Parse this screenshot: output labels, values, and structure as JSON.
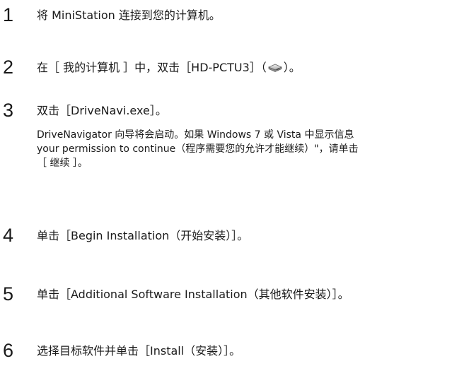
{
  "steps": [
    {
      "number": "1",
      "text": "将 MiniStation 连接到您的计算机。"
    },
    {
      "number": "2",
      "text_before": "在［ 我的计算机 ］中，双击［HD-PCTU3］（",
      "icon": "drive-icon",
      "text_after": "）。"
    },
    {
      "number": "3",
      "text": "双击［DriveNavi.exe］。",
      "sub_lines": [
        "DriveNavigator 向导将会启动。如果 Windows 7 或 Vista 中显示信息",
        "your permission to continue（程序需要您的允许才能继续）\"，请单击",
        "［ 继续 ］。"
      ]
    },
    {
      "number": "4",
      "text": "单击［Begin Installation（开始安装）］。"
    },
    {
      "number": "5",
      "text": "单击［Additional Software Installation（其他软件安装）］。"
    },
    {
      "number": "6",
      "text": "选择目标软件并单击［Install（安装）］。"
    }
  ]
}
